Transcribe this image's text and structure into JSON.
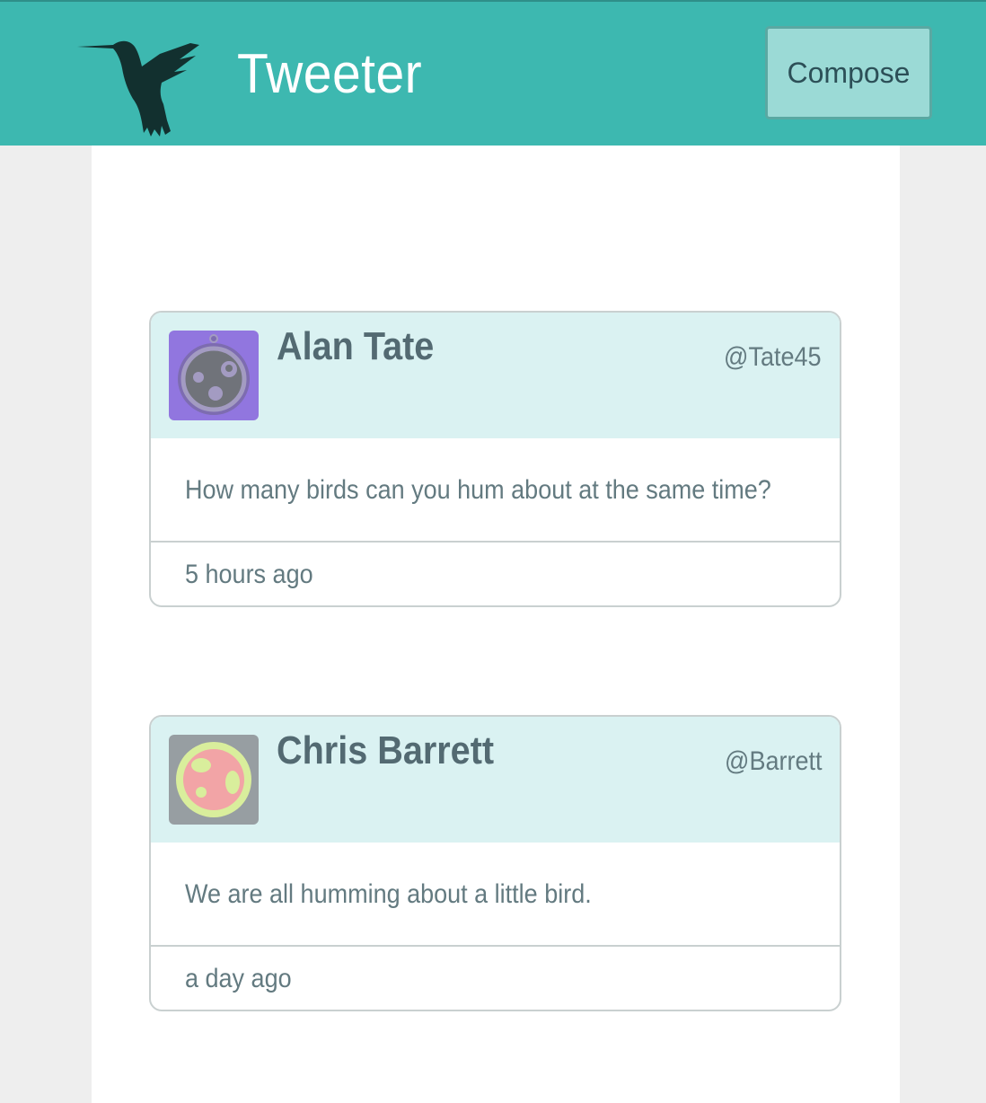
{
  "header": {
    "brand": "Tweeter",
    "compose_label": "Compose",
    "logo_icon": "hummingbird-icon",
    "background": "#3db8b0"
  },
  "tweets": [
    {
      "name": "Alan Tate",
      "handle": "@Tate45",
      "text": "How many birds can you hum about at the same time?",
      "time": "5 hours ago",
      "avatar_icon": "robot-face-avatar-purple"
    },
    {
      "name": "Chris Barrett",
      "handle": "@Barrett",
      "text": "We are all humming about a little bird.",
      "time": "a day ago",
      "avatar_icon": "robot-face-avatar-pink"
    }
  ]
}
